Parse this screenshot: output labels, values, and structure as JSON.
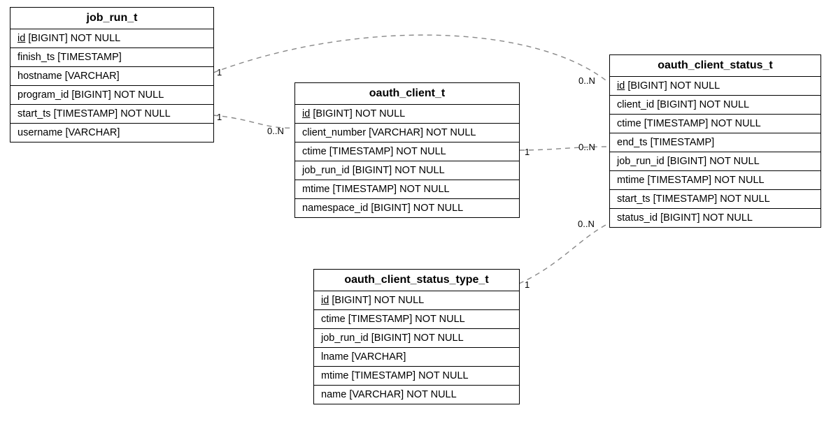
{
  "entities": {
    "job_run_t": {
      "title": "job_run_t",
      "columns": [
        {
          "name": "id",
          "type": "[BIGINT]",
          "constraint": "NOT NULL",
          "pk": true
        },
        {
          "name": "finish_ts",
          "type": "[TIMESTAMP]",
          "constraint": "",
          "pk": false
        },
        {
          "name": "hostname",
          "type": "[VARCHAR]",
          "constraint": "",
          "pk": false
        },
        {
          "name": "program_id",
          "type": "[BIGINT]",
          "constraint": "NOT NULL",
          "pk": false
        },
        {
          "name": "start_ts",
          "type": "[TIMESTAMP]",
          "constraint": "NOT NULL",
          "pk": false
        },
        {
          "name": "username",
          "type": "[VARCHAR]",
          "constraint": "",
          "pk": false
        }
      ]
    },
    "oauth_client_t": {
      "title": "oauth_client_t",
      "columns": [
        {
          "name": "id",
          "type": "[BIGINT]",
          "constraint": "NOT NULL",
          "pk": true
        },
        {
          "name": "client_number",
          "type": "[VARCHAR]",
          "constraint": "NOT NULL",
          "pk": false
        },
        {
          "name": "ctime",
          "type": "[TIMESTAMP]",
          "constraint": "NOT NULL",
          "pk": false
        },
        {
          "name": "job_run_id",
          "type": "[BIGINT]",
          "constraint": "NOT NULL",
          "pk": false
        },
        {
          "name": "mtime",
          "type": "[TIMESTAMP]",
          "constraint": "NOT NULL",
          "pk": false
        },
        {
          "name": "namespace_id",
          "type": "[BIGINT]",
          "constraint": "NOT NULL",
          "pk": false
        }
      ]
    },
    "oauth_client_status_t": {
      "title": "oauth_client_status_t",
      "columns": [
        {
          "name": "id",
          "type": "[BIGINT]",
          "constraint": "NOT NULL",
          "pk": true
        },
        {
          "name": "client_id",
          "type": "[BIGINT]",
          "constraint": "NOT NULL",
          "pk": false
        },
        {
          "name": "ctime",
          "type": "[TIMESTAMP]",
          "constraint": "NOT NULL",
          "pk": false
        },
        {
          "name": "end_ts",
          "type": "[TIMESTAMP]",
          "constraint": "",
          "pk": false
        },
        {
          "name": "job_run_id",
          "type": "[BIGINT]",
          "constraint": "NOT NULL",
          "pk": false
        },
        {
          "name": "mtime",
          "type": "[TIMESTAMP]",
          "constraint": "NOT NULL",
          "pk": false
        },
        {
          "name": "start_ts",
          "type": "[TIMESTAMP]",
          "constraint": "NOT NULL",
          "pk": false
        },
        {
          "name": "status_id",
          "type": "[BIGINT]",
          "constraint": "NOT NULL",
          "pk": false
        }
      ]
    },
    "oauth_client_status_type_t": {
      "title": "oauth_client_status_type_t",
      "columns": [
        {
          "name": "id",
          "type": "[BIGINT]",
          "constraint": "NOT NULL",
          "pk": true
        },
        {
          "name": "ctime",
          "type": "[TIMESTAMP]",
          "constraint": "NOT NULL",
          "pk": false
        },
        {
          "name": "job_run_id",
          "type": "[BIGINT]",
          "constraint": "NOT NULL",
          "pk": false
        },
        {
          "name": "lname",
          "type": "[VARCHAR]",
          "constraint": "",
          "pk": false
        },
        {
          "name": "mtime",
          "type": "[TIMESTAMP]",
          "constraint": "NOT NULL",
          "pk": false
        },
        {
          "name": "name",
          "type": "[VARCHAR]",
          "constraint": "NOT NULL",
          "pk": false
        }
      ]
    }
  },
  "relationships": [
    {
      "from": "job_run_t",
      "to": "oauth_client_status_t",
      "from_card": "1",
      "to_card": "0..N"
    },
    {
      "from": "job_run_t",
      "to": "oauth_client_t",
      "from_card": "1",
      "to_card": "0..N"
    },
    {
      "from": "oauth_client_t",
      "to": "oauth_client_status_t",
      "from_card": "1",
      "to_card": "0..N"
    },
    {
      "from": "oauth_client_status_type_t",
      "to": "oauth_client_status_t",
      "from_card": "1",
      "to_card": "0..N"
    }
  ],
  "cardinality_labels": {
    "c1": "1",
    "c2": "0..N",
    "c3": "1",
    "c4": "0..N",
    "c5": "1",
    "c6": "0..N",
    "c7": "1",
    "c8": "0..N"
  }
}
